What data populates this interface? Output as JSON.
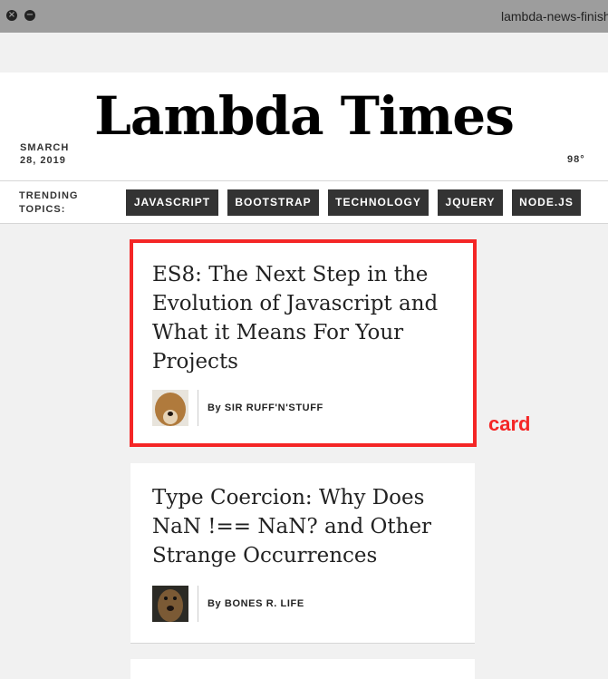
{
  "window": {
    "title": "lambda-news-finish",
    "close_symbol": "×",
    "minimize_symbol": "−"
  },
  "header": {
    "date_line1": "SMARCH",
    "date_line2": "28, 2019",
    "title": "Lambda Times",
    "temperature": "98°"
  },
  "topics": {
    "label_line1": "TRENDING",
    "label_line2": "TOPICS:",
    "tabs": [
      "JAVASCRIPT",
      "BOOTSTRAP",
      "TECHNOLOGY",
      "JQUERY",
      "NODE.JS"
    ]
  },
  "cards": [
    {
      "headline": "ES8: The Next Step in the Evolution of Javascript and What it Means For Your Projects",
      "author": "By SIR RUFF'N'STUFF"
    },
    {
      "headline": "Type Coercion: Why Does NaN !== NaN? and Other Strange Occurrences",
      "author": "By BONES R. LIFE"
    }
  ],
  "annotation": {
    "label": "card",
    "color": "#f42626"
  },
  "colors": {
    "tab_bg": "#333333",
    "page_bg": "#f1f1f1",
    "card_bg": "#ffffff"
  }
}
